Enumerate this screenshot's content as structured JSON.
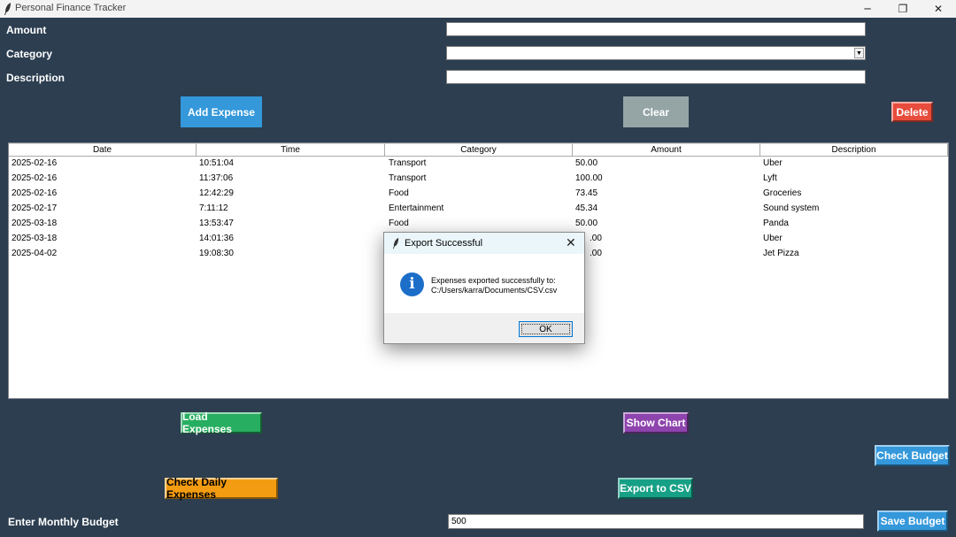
{
  "window": {
    "title": "Personal Finance Tracker",
    "min_glyph": "─",
    "max_glyph": "❐",
    "close_glyph": "✕"
  },
  "form": {
    "amount_label": "Amount",
    "amount_value": "",
    "category_label": "Category",
    "category_value": "",
    "description_label": "Description",
    "description_value": ""
  },
  "buttons": {
    "add_expense": "Add Expense",
    "clear": "Clear",
    "delete": "Delete",
    "load_expenses": "Load Expenses",
    "show_chart": "Show Chart",
    "check_budget": "Check Budget",
    "check_daily_expenses": "Check Daily Expenses",
    "export_csv": "Export to CSV",
    "save_budget": "Save Budget"
  },
  "colors": {
    "background": "#2c3e50",
    "add_expense": "#3498db",
    "clear": "#95a5a6",
    "delete": "#e74c3c",
    "load_expenses": "#27ae60",
    "show_chart": "#8e44ad",
    "check_budget": "#3498db",
    "check_daily_expenses": "#f39c12",
    "export_csv": "#16a085",
    "save_budget": "#3498db"
  },
  "table": {
    "headers": [
      "Date",
      "Time",
      "Category",
      "Amount",
      "Description"
    ],
    "rows": [
      [
        "2025-02-16",
        "10:51:04",
        "Transport",
        "50.00",
        "Uber"
      ],
      [
        "2025-02-16",
        "11:37:06",
        "Transport",
        "100.00",
        "Lyft"
      ],
      [
        "2025-02-16",
        "12:42:29",
        "Food",
        "73.45",
        "Groceries"
      ],
      [
        "2025-02-17",
        "7:11:12",
        "Entertainment",
        "45.34",
        "Sound system"
      ],
      [
        "2025-03-18",
        "13:53:47",
        "Food",
        "50.00",
        "Panda"
      ],
      [
        "2025-03-18",
        "14:01:36",
        "",
        ".00",
        "Uber"
      ],
      [
        "2025-04-02",
        "19:08:30",
        "",
        ".00",
        "Jet Pizza"
      ]
    ]
  },
  "budget": {
    "label": "Enter Monthly Budget",
    "value": "500"
  },
  "dialog": {
    "title": "Export Successful",
    "message_line1": "Expenses exported successfully to:",
    "message_line2": "C:/Users/karra/Documents/CSV.csv",
    "ok_label": "OK",
    "icon": "info-icon",
    "icon_glyph": "i",
    "close_glyph": "✕"
  }
}
